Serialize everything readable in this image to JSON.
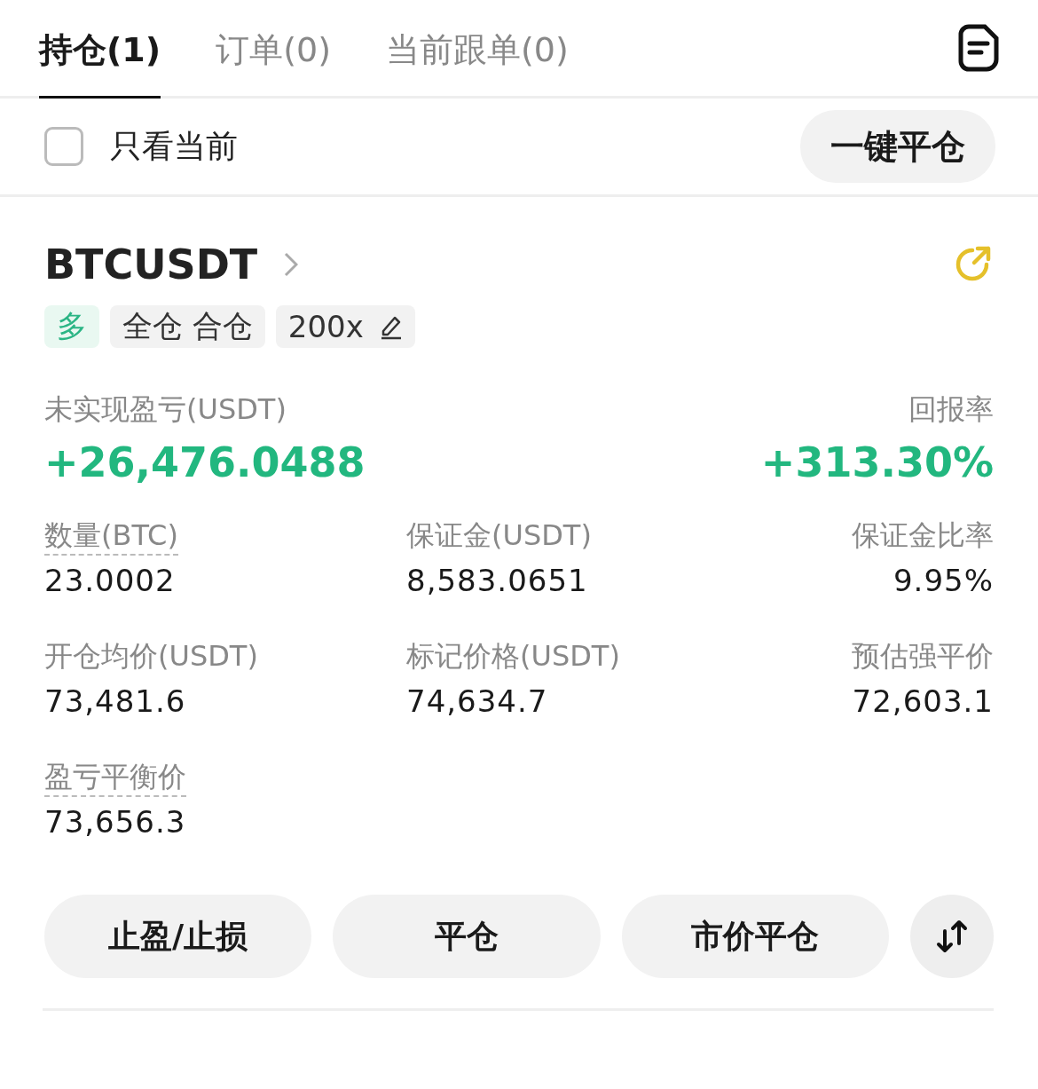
{
  "tabs": [
    {
      "label": "持仓(1)",
      "selected": true
    },
    {
      "label": "订单(0)",
      "selected": false
    },
    {
      "label": "当前跟单(0)",
      "selected": false
    }
  ],
  "filter": {
    "label": "只看当前",
    "checked": false
  },
  "close_all_button": "一键平仓",
  "position": {
    "symbol": "BTCUSDT",
    "tags": [
      {
        "label": "多",
        "kind": "side"
      },
      {
        "label": "全仓 合仓",
        "kind": "mode"
      },
      {
        "label": "200x",
        "kind": "leverage"
      }
    ],
    "pnl": {
      "label": "未实现盈亏(USDT)",
      "value": "+26,476.0488"
    },
    "roe": {
      "label": "回报率",
      "value": "+313.30%"
    },
    "fields": [
      {
        "label": "数量(BTC)",
        "value": "23.0002",
        "hint": true
      },
      {
        "label": "保证金(USDT)",
        "value": "8,583.0651",
        "hint": false
      },
      {
        "label": "保证金比率",
        "value": "9.95%",
        "hint": false
      },
      {
        "label": "开仓均价(USDT)",
        "value": "73,481.6",
        "hint": false
      },
      {
        "label": "标记价格(USDT)",
        "value": "74,634.7",
        "hint": false
      },
      {
        "label": "预估强平价",
        "value": "72,603.1",
        "hint": false
      },
      {
        "label": "盈亏平衡价",
        "value": "73,656.3",
        "hint": true
      }
    ],
    "actions": [
      "止盈/止损",
      "平仓",
      "市价平仓"
    ]
  }
}
